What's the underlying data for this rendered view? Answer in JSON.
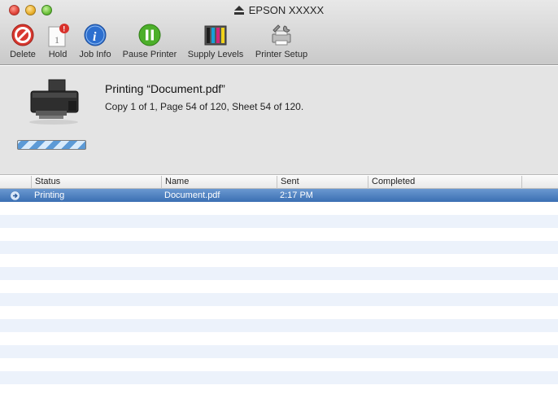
{
  "window": {
    "title": "EPSON XXXXX"
  },
  "toolbar": {
    "items": [
      {
        "label": "Delete",
        "icon": "delete-icon"
      },
      {
        "label": "Hold",
        "icon": "hold-icon"
      },
      {
        "label": "Job Info",
        "icon": "info-icon"
      },
      {
        "label": "Pause Printer",
        "icon": "pause-icon"
      },
      {
        "label": "Supply Levels",
        "icon": "ink-levels-icon"
      },
      {
        "label": "Printer Setup",
        "icon": "printer-setup-icon"
      }
    ]
  },
  "status": {
    "job_title": "Printing “Document.pdf”",
    "job_detail": "Copy 1 of 1, Page 54 of 120, Sheet 54 of 120."
  },
  "table": {
    "headers": [
      "Status",
      "Name",
      "Sent",
      "Completed"
    ],
    "rows": [
      {
        "status": "Printing",
        "name": "Document.pdf",
        "sent": "2:17 PM",
        "completed": ""
      }
    ]
  },
  "colors": {
    "selection": "#3a6fb3",
    "alt_row": "#ecf2fb",
    "progress": "#5c9ad6"
  }
}
